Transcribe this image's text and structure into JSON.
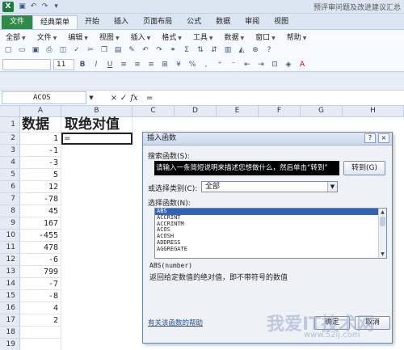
{
  "window": {
    "title": "预评审问题及改进建议汇总"
  },
  "tabs": [
    "文件",
    "经典菜单",
    "开始",
    "插入",
    "页面布局",
    "公式",
    "数据",
    "审阅",
    "视图"
  ],
  "menu": [
    "全部",
    "文件",
    "编辑",
    "视图",
    "插入",
    "格式",
    "工具",
    "数据",
    "窗口",
    "帮助"
  ],
  "toolbar": {
    "font_size": "11"
  },
  "formula_bar": {
    "name_box": "ACOS",
    "cancel": "×",
    "enter": "✓",
    "fx": "fx",
    "content": "="
  },
  "columns": [
    "A",
    "B",
    "C",
    "D",
    "E",
    "F",
    "G",
    "H"
  ],
  "rows": [
    "1",
    "2",
    "3",
    "4",
    "5",
    "6",
    "7",
    "8",
    "9",
    "10",
    "11",
    "12",
    "13",
    "14",
    "15",
    "16",
    "17",
    "18",
    "19"
  ],
  "sheet": {
    "header_a": "数据",
    "header_b": "取绝对值",
    "b2": "=",
    "values_a": [
      "1",
      "-1",
      "-3",
      "5",
      "12",
      "-78",
      "45",
      "167",
      "-455",
      "478",
      "-6",
      "799",
      "-7",
      "-8",
      "4",
      "2"
    ]
  },
  "dialog": {
    "title": "插入函数",
    "help_btn": "?",
    "close_btn": "×",
    "search_label": "搜索函数(S):",
    "search_value": "请输入一条简短说明来描述您想做什么，然后单击“转到”",
    "go_button": "转到(G)",
    "category_label": "或选择类别(C):",
    "category_value": "全部",
    "list_label": "选择函数(N):",
    "functions": [
      "ABS",
      "ACCRINT",
      "ACCRINTM",
      "ACOS",
      "ACOSH",
      "ADDRESS",
      "AGGREGATE"
    ],
    "signature": "ABS(number)",
    "description": "返回给定数值的绝对值，即不带符号的数值",
    "help_link": "有关该函数的帮助",
    "ok": "确定",
    "cancel": "取消"
  },
  "watermark": {
    "text": "我爱IT技术网",
    "url": "www.52ij.com"
  }
}
